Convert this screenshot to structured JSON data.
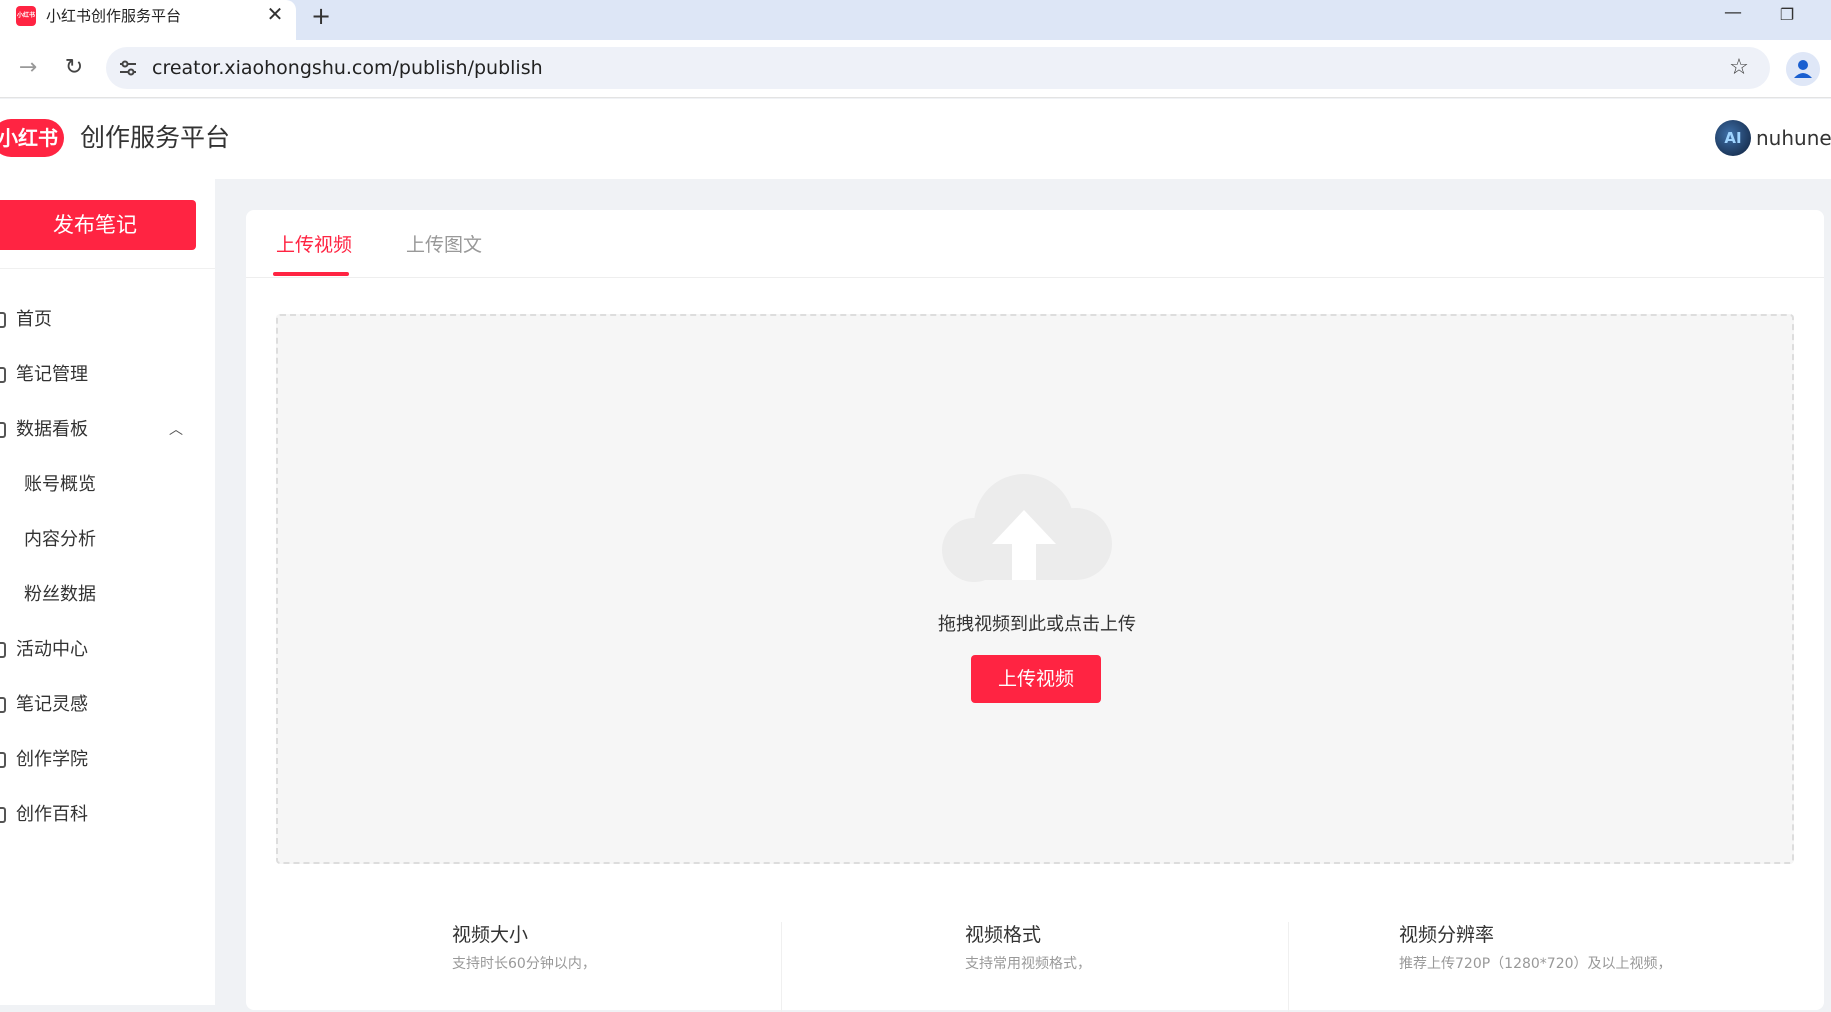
{
  "browser": {
    "tab_title": "小红书创作服务平台",
    "favicon_text": "小红书",
    "url": "creator.xiaohongshu.com/publish/publish",
    "icons": {
      "close": "close-icon",
      "new_tab": "plus-icon",
      "forward": "arrow-right-icon",
      "reload": "reload-icon",
      "site_info": "tune-icon",
      "bookmark": "star-icon",
      "profile": "person-icon",
      "minimize": "minimize-icon",
      "restore": "restore-icon"
    }
  },
  "header": {
    "logo_text": "小红书",
    "title": "创作服务平台",
    "avatar_text": "AI",
    "username": "nuhune"
  },
  "sidebar": {
    "publish_label": "发布笔记",
    "items": [
      {
        "label": "首页",
        "icon": "home-icon"
      },
      {
        "label": "笔记管理",
        "icon": "note-icon"
      },
      {
        "label": "数据看板",
        "icon": "chart-icon",
        "expanded": true
      },
      {
        "label": "账号概览"
      },
      {
        "label": "内容分析"
      },
      {
        "label": "粉丝数据"
      },
      {
        "label": "活动中心",
        "icon": "activity-icon"
      },
      {
        "label": "笔记灵感",
        "icon": "inspiration-icon"
      },
      {
        "label": "创作学院",
        "icon": "academy-icon"
      },
      {
        "label": "创作百科",
        "icon": "wiki-icon"
      }
    ]
  },
  "main": {
    "tabs": [
      {
        "label": "上传视频",
        "active": true
      },
      {
        "label": "上传图文",
        "active": false
      }
    ],
    "dropzone": {
      "text": "拖拽视频到此或点击上传",
      "button_label": "上传视频",
      "icon": "cloud-upload-icon"
    },
    "info": [
      {
        "title": "视频大小",
        "desc": "支持时长60分钟以内，"
      },
      {
        "title": "视频格式",
        "desc": "支持常用视频格式，"
      },
      {
        "title": "视频分辨率",
        "desc": "推荐上传720P（1280*720）及以上视频，"
      }
    ]
  },
  "colors": {
    "brand": "#ff2442",
    "page_bg": "#f0f2f5",
    "dropzone_bg": "#f6f6f6"
  }
}
